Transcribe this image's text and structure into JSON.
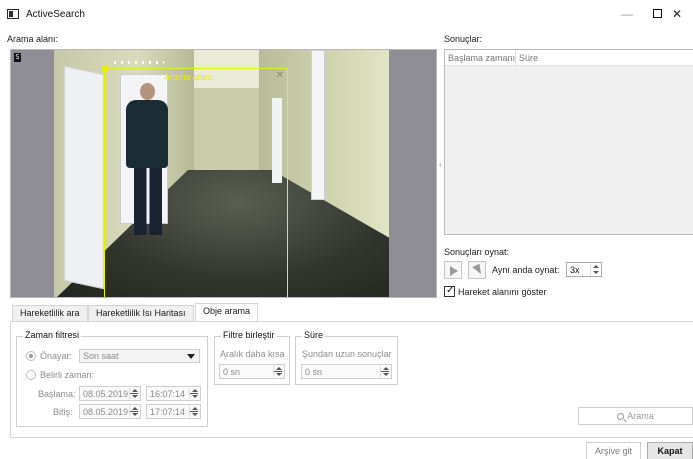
{
  "window": {
    "title": "ActiveSearch",
    "min_glyph": "—",
    "close_glyph": "✕"
  },
  "search_area": {
    "label": "Arama alanı:",
    "roi_label": "Arama alanı",
    "roi_color": "#e8f000",
    "stamp": "S"
  },
  "results": {
    "label": "Sonuçlar:",
    "columns": [
      "Başlama zamanı",
      "Süre"
    ]
  },
  "playback": {
    "label": "Sonuçları oynat:",
    "play_icon": "play-icon",
    "step_icon": "cursor-icon",
    "simultaneous_label": "Aynı anda oynat:",
    "simultaneous_value": "3x",
    "show_motion_label": "Hareket alanını göster",
    "show_motion_checked": true
  },
  "tabs": [
    {
      "label": "Hareketlilik ara",
      "active": false
    },
    {
      "label": "Hareketlilik Isı Haritası",
      "active": false
    },
    {
      "label": "Obje arama",
      "active": true
    }
  ],
  "time_filter": {
    "title": "Zaman filtresi",
    "preset_label": "Önayar:",
    "preset_value": "Son saat",
    "custom_label": "Belirli zaman:",
    "start_label": "Başlama:",
    "start_date": "08.05.2019",
    "start_time": "16:07:14",
    "end_label": "Bitiş:",
    "end_date": "08.05.2019",
    "end_time": "17:07:14"
  },
  "merge_filter": {
    "title": "Filtre birleştir",
    "interval_label": "Aralık daha kısa",
    "interval_value": "0 sn"
  },
  "duration": {
    "title": "Süre",
    "longer_label": "Şundan uzun sonuçlar",
    "longer_value": "0 sn"
  },
  "buttons": {
    "search": "Arama",
    "archive": "Arşive git",
    "close": "Kapat"
  }
}
